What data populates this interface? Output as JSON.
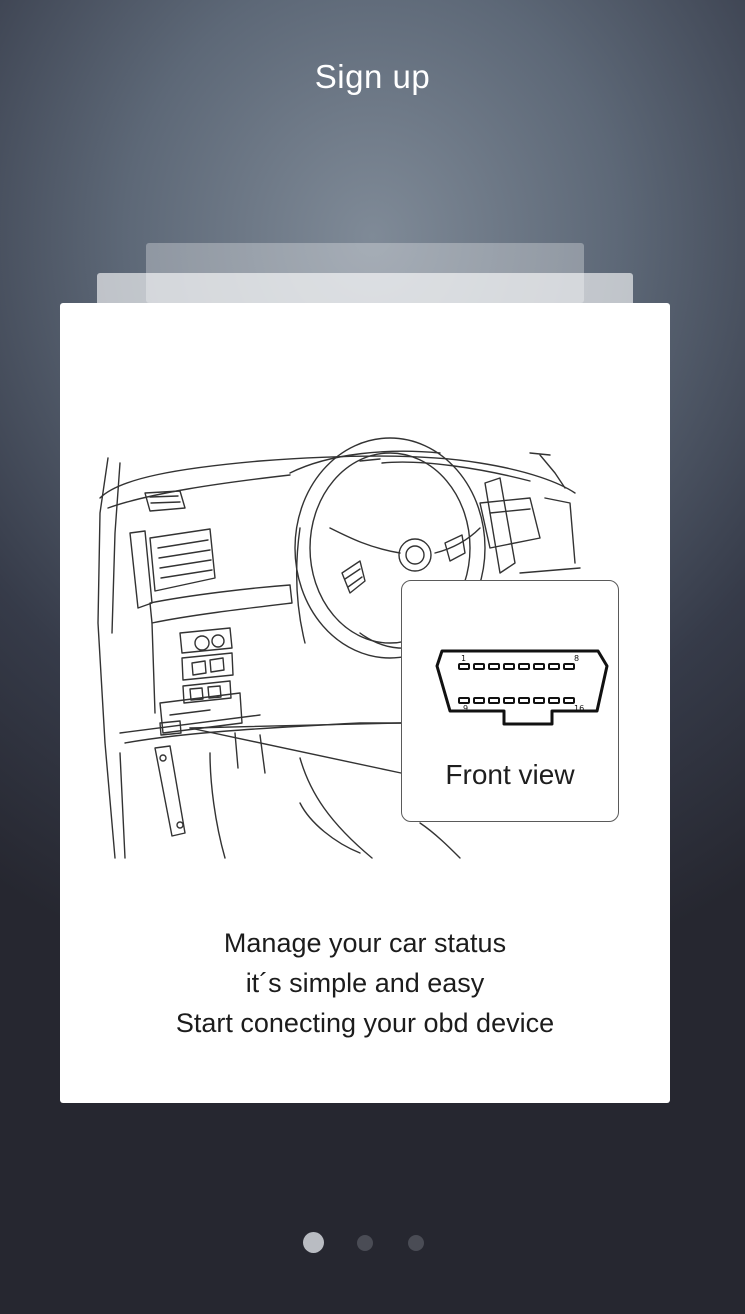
{
  "header": {
    "title": "Sign up"
  },
  "card": {
    "callout_label": "Front view",
    "connector_pins": {
      "top_left": "1",
      "top_right": "8",
      "bottom_left": "9",
      "bottom_right": "16"
    },
    "description": [
      "Manage your car status",
      "it´s simple and easy",
      "Start conecting your obd device"
    ]
  },
  "pager": {
    "pages": 3,
    "current": 1
  }
}
